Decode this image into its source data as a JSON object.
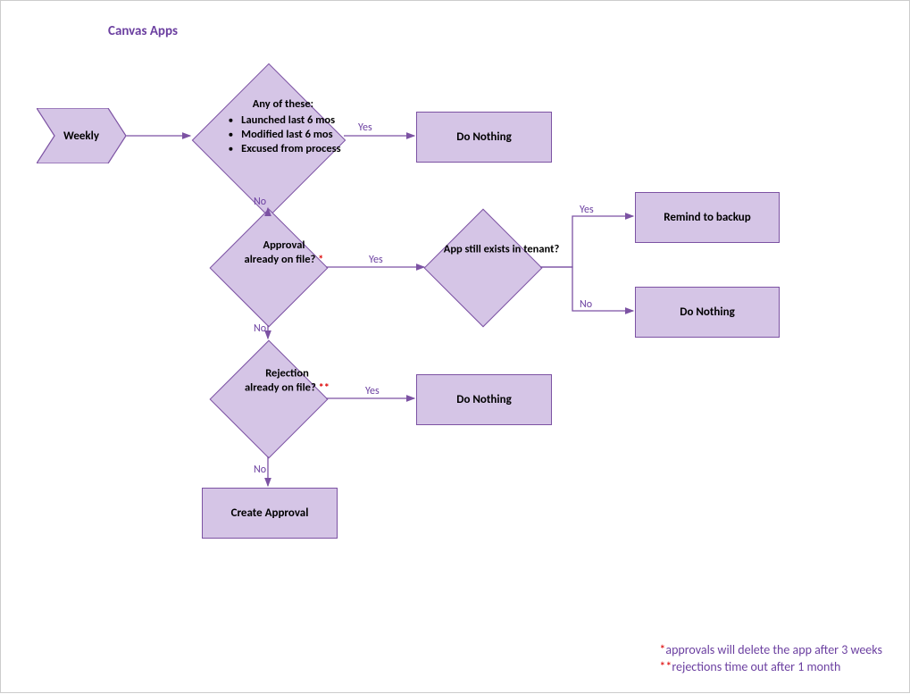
{
  "title": "Canvas Apps",
  "start": {
    "label": "Weekly"
  },
  "decisions": {
    "d1": {
      "heading": "Any of these:",
      "items": [
        "Launched last 6 mos",
        "Modified last 6 mos",
        "Excused from process"
      ]
    },
    "d2": {
      "line1": "Approval",
      "line2": "already on file? ",
      "marker": "*"
    },
    "d3": {
      "line1": "Rejection",
      "line2": "already on file? ",
      "marker": "**"
    },
    "d4": {
      "line1": "App still exists in tenant?"
    }
  },
  "processes": {
    "p1": "Do Nothing",
    "p2": "Remind to backup",
    "p3": "Do Nothing",
    "p4": "Do Nothing",
    "p5": "Create Approval"
  },
  "labels": {
    "yes": "Yes",
    "no": "No"
  },
  "footnotes": {
    "f1_marker": "*",
    "f1_text": "approvals will delete the app after 3 weeks",
    "f2_marker": "**",
    "f2_text": "rejections time out after 1 month"
  },
  "colors": {
    "stroke": "#7c52a3",
    "fill": "#d5c5e6",
    "text": "#6b3fa0"
  },
  "chart_data": {
    "type": "flowchart",
    "nodes": [
      {
        "id": "start",
        "type": "start",
        "label": "Weekly"
      },
      {
        "id": "d1",
        "type": "decision",
        "label": "Any of these: Launched last 6 mos / Modified last 6 mos / Excused from process"
      },
      {
        "id": "p1",
        "type": "process",
        "label": "Do Nothing"
      },
      {
        "id": "d2",
        "type": "decision",
        "label": "Approval already on file? *"
      },
      {
        "id": "d4",
        "type": "decision",
        "label": "App still exists in tenant?"
      },
      {
        "id": "p2",
        "type": "process",
        "label": "Remind to backup"
      },
      {
        "id": "p3",
        "type": "process",
        "label": "Do Nothing"
      },
      {
        "id": "d3",
        "type": "decision",
        "label": "Rejection already on file? **"
      },
      {
        "id": "p4",
        "type": "process",
        "label": "Do Nothing"
      },
      {
        "id": "p5",
        "type": "process",
        "label": "Create Approval"
      }
    ],
    "edges": [
      {
        "from": "start",
        "to": "d1",
        "label": ""
      },
      {
        "from": "d1",
        "to": "p1",
        "label": "Yes"
      },
      {
        "from": "d1",
        "to": "d2",
        "label": "No"
      },
      {
        "from": "d2",
        "to": "d4",
        "label": "Yes"
      },
      {
        "from": "d4",
        "to": "p2",
        "label": "Yes"
      },
      {
        "from": "d4",
        "to": "p3",
        "label": "No"
      },
      {
        "from": "d2",
        "to": "d3",
        "label": "No"
      },
      {
        "from": "d3",
        "to": "p4",
        "label": "Yes"
      },
      {
        "from": "d3",
        "to": "p5",
        "label": "No"
      }
    ]
  }
}
